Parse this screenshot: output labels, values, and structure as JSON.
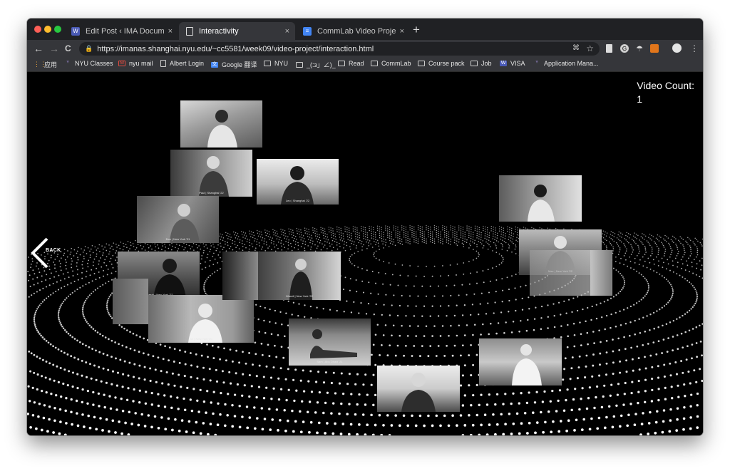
{
  "browser": {
    "tabs": [
      {
        "label": "Edit Post ‹ IMA Documentation",
        "close": "×",
        "favicon": "wordpress-icon",
        "fav_color": "#4a5ab6"
      },
      {
        "label": "Interactivity",
        "close": "×",
        "favicon": "page-icon",
        "fav_color": "#9aa0a6"
      },
      {
        "label": "CommLab Video Project Propo",
        "close": "×",
        "favicon": "docs-icon",
        "fav_color": "#4285f4"
      }
    ],
    "new_tab": "+",
    "url": "https://imanas.shanghai.nyu.edu/~cc5581/week09/video-project/interaction.html",
    "nav": {
      "back": "←",
      "forward": "→",
      "reload": "C"
    },
    "bookmarks": [
      {
        "label": "应用"
      },
      {
        "label": "NYU Classes"
      },
      {
        "label": "nyu mail"
      },
      {
        "label": "Albert Login"
      },
      {
        "label": "Google 翻译"
      },
      {
        "label": "NYU"
      },
      {
        "label": "_(:з」∠)_"
      },
      {
        "label": "Read"
      },
      {
        "label": "CommLab"
      },
      {
        "label": "Course pack"
      },
      {
        "label": "Job"
      },
      {
        "label": "VISA"
      },
      {
        "label": "Application Mana..."
      }
    ]
  },
  "page": {
    "video_count_label": "Video Count:",
    "video_count_value": "1",
    "back_label": "BACK",
    "thumbnails": [
      {
        "caption": ""
      },
      {
        "caption": "Paul | Shanghai '22"
      },
      {
        "caption": "Leo | Shanghai '22"
      },
      {
        "caption": "Dan | New York '21"
      },
      {
        "caption": "Takeshi | New York '22"
      },
      {
        "caption": "Ari | New York '20"
      },
      {
        "caption": "Wandi | New York '22"
      },
      {
        "caption": "Sam | Abu Dhabi '21"
      },
      {
        "caption": ""
      },
      {
        "caption": "Max | New York '22"
      },
      {
        "caption": ""
      },
      {
        "caption": ""
      },
      {
        "caption": ""
      }
    ]
  }
}
